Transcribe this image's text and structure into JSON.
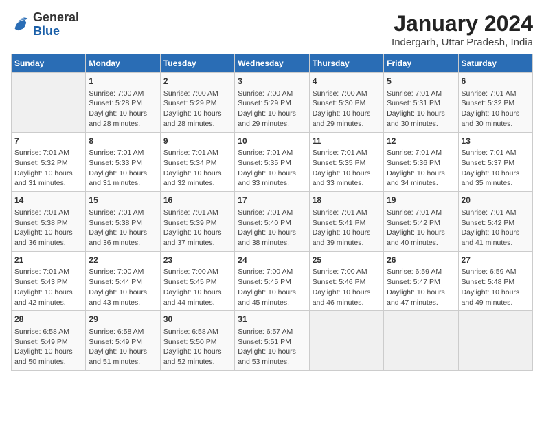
{
  "header": {
    "logo_general": "General",
    "logo_blue": "Blue",
    "title": "January 2024",
    "subtitle": "Indergarh, Uttar Pradesh, India"
  },
  "days_of_week": [
    "Sunday",
    "Monday",
    "Tuesday",
    "Wednesday",
    "Thursday",
    "Friday",
    "Saturday"
  ],
  "weeks": [
    [
      {
        "day": "",
        "empty": true
      },
      {
        "day": "1",
        "sunrise": "7:00 AM",
        "sunset": "5:28 PM",
        "daylight": "10 hours and 28 minutes."
      },
      {
        "day": "2",
        "sunrise": "7:00 AM",
        "sunset": "5:29 PM",
        "daylight": "10 hours and 28 minutes."
      },
      {
        "day": "3",
        "sunrise": "7:00 AM",
        "sunset": "5:29 PM",
        "daylight": "10 hours and 29 minutes."
      },
      {
        "day": "4",
        "sunrise": "7:00 AM",
        "sunset": "5:30 PM",
        "daylight": "10 hours and 29 minutes."
      },
      {
        "day": "5",
        "sunrise": "7:01 AM",
        "sunset": "5:31 PM",
        "daylight": "10 hours and 30 minutes."
      },
      {
        "day": "6",
        "sunrise": "7:01 AM",
        "sunset": "5:32 PM",
        "daylight": "10 hours and 30 minutes."
      }
    ],
    [
      {
        "day": "7",
        "sunrise": "7:01 AM",
        "sunset": "5:32 PM",
        "daylight": "10 hours and 31 minutes."
      },
      {
        "day": "8",
        "sunrise": "7:01 AM",
        "sunset": "5:33 PM",
        "daylight": "10 hours and 31 minutes."
      },
      {
        "day": "9",
        "sunrise": "7:01 AM",
        "sunset": "5:34 PM",
        "daylight": "10 hours and 32 minutes."
      },
      {
        "day": "10",
        "sunrise": "7:01 AM",
        "sunset": "5:35 PM",
        "daylight": "10 hours and 33 minutes."
      },
      {
        "day": "11",
        "sunrise": "7:01 AM",
        "sunset": "5:35 PM",
        "daylight": "10 hours and 33 minutes."
      },
      {
        "day": "12",
        "sunrise": "7:01 AM",
        "sunset": "5:36 PM",
        "daylight": "10 hours and 34 minutes."
      },
      {
        "day": "13",
        "sunrise": "7:01 AM",
        "sunset": "5:37 PM",
        "daylight": "10 hours and 35 minutes."
      }
    ],
    [
      {
        "day": "14",
        "sunrise": "7:01 AM",
        "sunset": "5:38 PM",
        "daylight": "10 hours and 36 minutes."
      },
      {
        "day": "15",
        "sunrise": "7:01 AM",
        "sunset": "5:38 PM",
        "daylight": "10 hours and 36 minutes."
      },
      {
        "day": "16",
        "sunrise": "7:01 AM",
        "sunset": "5:39 PM",
        "daylight": "10 hours and 37 minutes."
      },
      {
        "day": "17",
        "sunrise": "7:01 AM",
        "sunset": "5:40 PM",
        "daylight": "10 hours and 38 minutes."
      },
      {
        "day": "18",
        "sunrise": "7:01 AM",
        "sunset": "5:41 PM",
        "daylight": "10 hours and 39 minutes."
      },
      {
        "day": "19",
        "sunrise": "7:01 AM",
        "sunset": "5:42 PM",
        "daylight": "10 hours and 40 minutes."
      },
      {
        "day": "20",
        "sunrise": "7:01 AM",
        "sunset": "5:42 PM",
        "daylight": "10 hours and 41 minutes."
      }
    ],
    [
      {
        "day": "21",
        "sunrise": "7:01 AM",
        "sunset": "5:43 PM",
        "daylight": "10 hours and 42 minutes."
      },
      {
        "day": "22",
        "sunrise": "7:00 AM",
        "sunset": "5:44 PM",
        "daylight": "10 hours and 43 minutes."
      },
      {
        "day": "23",
        "sunrise": "7:00 AM",
        "sunset": "5:45 PM",
        "daylight": "10 hours and 44 minutes."
      },
      {
        "day": "24",
        "sunrise": "7:00 AM",
        "sunset": "5:45 PM",
        "daylight": "10 hours and 45 minutes."
      },
      {
        "day": "25",
        "sunrise": "7:00 AM",
        "sunset": "5:46 PM",
        "daylight": "10 hours and 46 minutes."
      },
      {
        "day": "26",
        "sunrise": "6:59 AM",
        "sunset": "5:47 PM",
        "daylight": "10 hours and 47 minutes."
      },
      {
        "day": "27",
        "sunrise": "6:59 AM",
        "sunset": "5:48 PM",
        "daylight": "10 hours and 49 minutes."
      }
    ],
    [
      {
        "day": "28",
        "sunrise": "6:58 AM",
        "sunset": "5:49 PM",
        "daylight": "10 hours and 50 minutes."
      },
      {
        "day": "29",
        "sunrise": "6:58 AM",
        "sunset": "5:49 PM",
        "daylight": "10 hours and 51 minutes."
      },
      {
        "day": "30",
        "sunrise": "6:58 AM",
        "sunset": "5:50 PM",
        "daylight": "10 hours and 52 minutes."
      },
      {
        "day": "31",
        "sunrise": "6:57 AM",
        "sunset": "5:51 PM",
        "daylight": "10 hours and 53 minutes."
      },
      {
        "day": "",
        "empty": true
      },
      {
        "day": "",
        "empty": true
      },
      {
        "day": "",
        "empty": true
      }
    ]
  ],
  "labels": {
    "sunrise": "Sunrise:",
    "sunset": "Sunset:",
    "daylight": "Daylight:"
  }
}
